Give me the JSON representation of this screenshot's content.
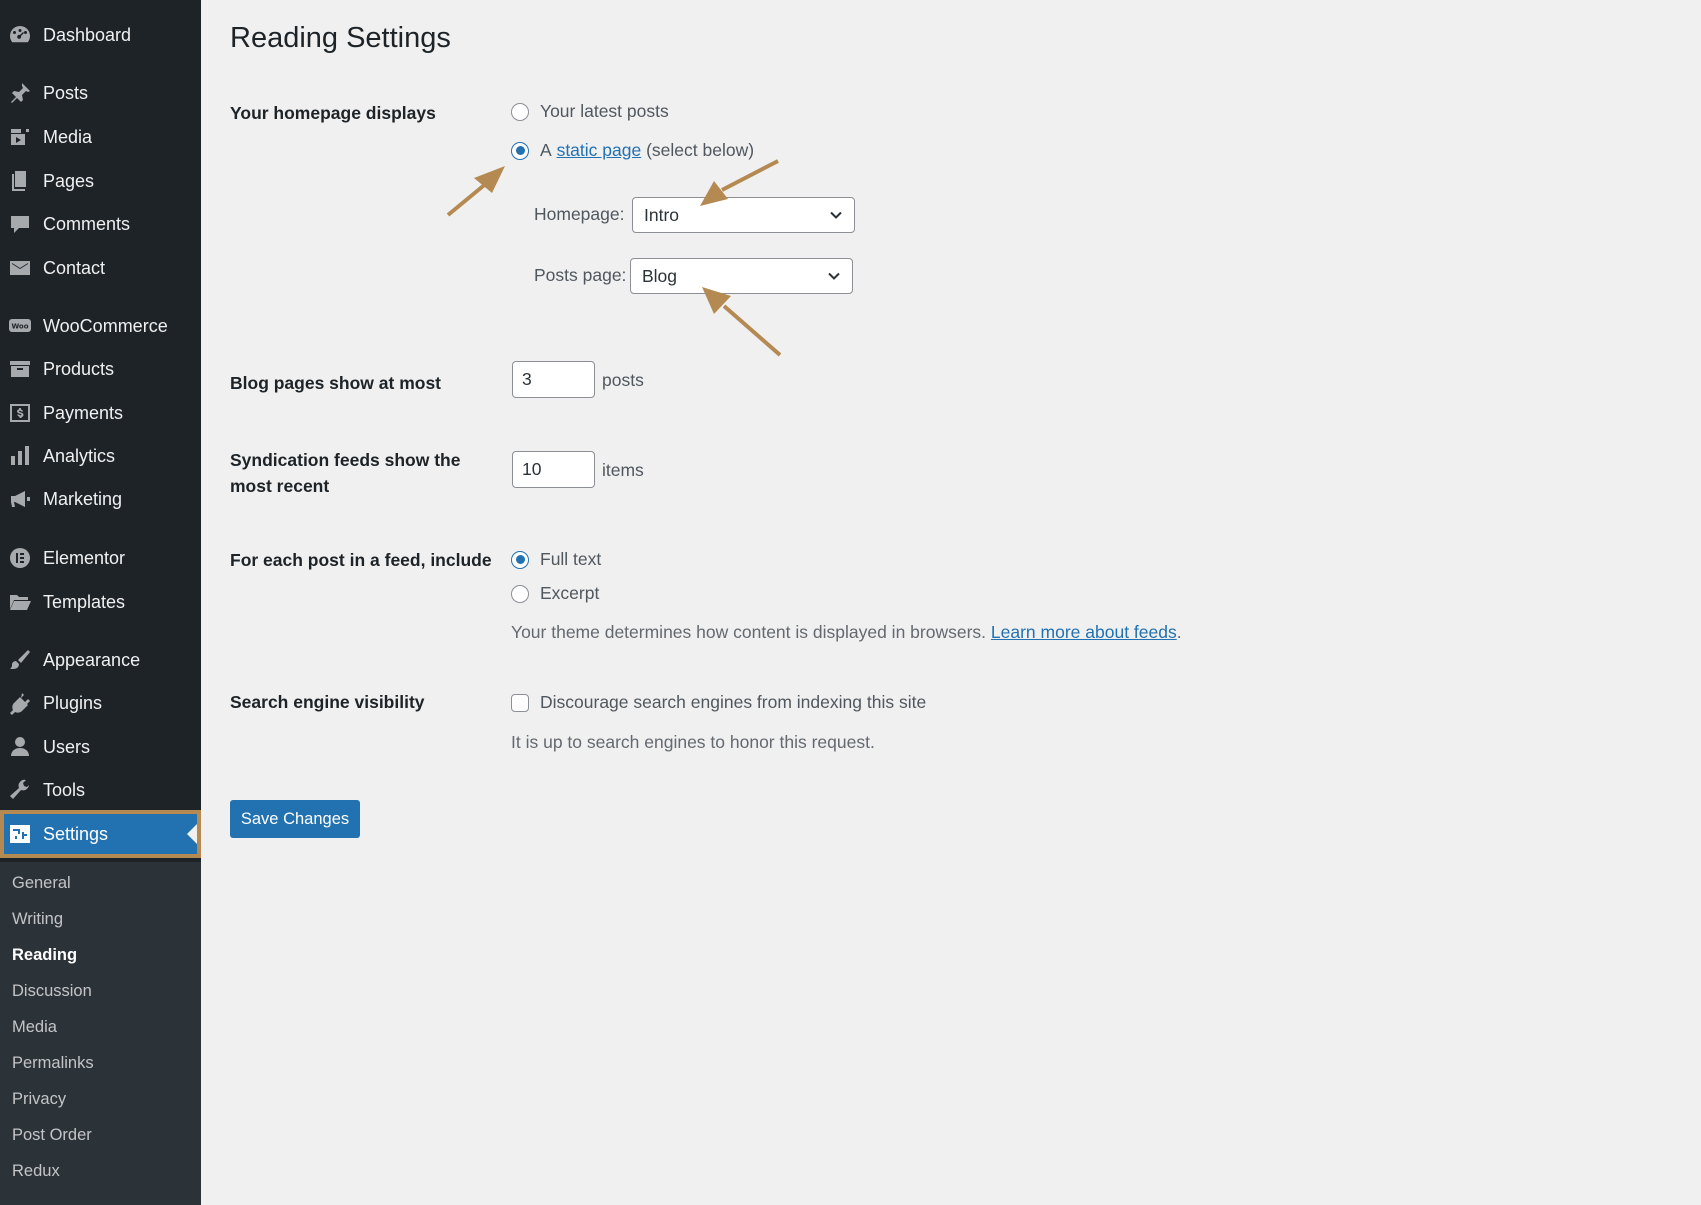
{
  "sidebar": {
    "items": [
      {
        "label": "Dashboard",
        "icon": "dashboard-icon"
      },
      {
        "label": "Posts",
        "icon": "pushpin-icon"
      },
      {
        "label": "Media",
        "icon": "media-icon"
      },
      {
        "label": "Pages",
        "icon": "pages-icon"
      },
      {
        "label": "Comments",
        "icon": "comment-icon"
      },
      {
        "label": "Contact",
        "icon": "envelope-icon"
      },
      {
        "label": "WooCommerce",
        "icon": "woocommerce-icon"
      },
      {
        "label": "Products",
        "icon": "archive-icon"
      },
      {
        "label": "Payments",
        "icon": "dollar-icon"
      },
      {
        "label": "Analytics",
        "icon": "bar-chart-icon"
      },
      {
        "label": "Marketing",
        "icon": "megaphone-icon"
      },
      {
        "label": "Elementor",
        "icon": "elementor-icon"
      },
      {
        "label": "Templates",
        "icon": "folder-icon"
      },
      {
        "label": "Appearance",
        "icon": "brush-icon"
      },
      {
        "label": "Plugins",
        "icon": "plug-icon"
      },
      {
        "label": "Users",
        "icon": "user-icon"
      },
      {
        "label": "Tools",
        "icon": "wrench-icon"
      },
      {
        "label": "Settings",
        "icon": "settings-icon",
        "current": true
      }
    ],
    "submenu": [
      {
        "label": "General"
      },
      {
        "label": "Writing"
      },
      {
        "label": "Reading",
        "active": true
      },
      {
        "label": "Discussion"
      },
      {
        "label": "Media"
      },
      {
        "label": "Permalinks"
      },
      {
        "label": "Privacy"
      },
      {
        "label": "Post Order"
      },
      {
        "label": "Redux"
      }
    ]
  },
  "page": {
    "title": "Reading Settings",
    "homepage_displays": {
      "label": "Your homepage displays",
      "option_latest": "Your latest posts",
      "option_static_prefix": "A",
      "option_static_link": "static page",
      "option_static_suffix": "(select below)",
      "selected": "static",
      "homepage_label": "Homepage:",
      "homepage_value": "Intro",
      "posts_page_label": "Posts page:",
      "posts_page_value": "Blog"
    },
    "blog_pages": {
      "label": "Blog pages show at most",
      "value": "3",
      "unit": "posts"
    },
    "syndication": {
      "label_line1": "Syndication feeds show the",
      "label_line2": "most recent",
      "value": "10",
      "unit": "items"
    },
    "feed_include": {
      "label": "For each post in a feed, include",
      "option_full": "Full text",
      "option_excerpt": "Excerpt",
      "selected": "full",
      "description": "Your theme determines how content is displayed in browsers.",
      "description_link": "Learn more about feeds",
      "description_end": "."
    },
    "search_visibility": {
      "label": "Search engine visibility",
      "checkbox_label": "Discourage search engines from indexing this site",
      "checked": false,
      "description": "It is up to search engines to honor this request."
    },
    "save_label": "Save Changes"
  },
  "colors": {
    "sidebar_bg": "#1d2327",
    "submenu_bg": "#2c3338",
    "accent": "#2271b1",
    "annotation": "#b58a52",
    "page_bg": "#f0f0f1"
  }
}
